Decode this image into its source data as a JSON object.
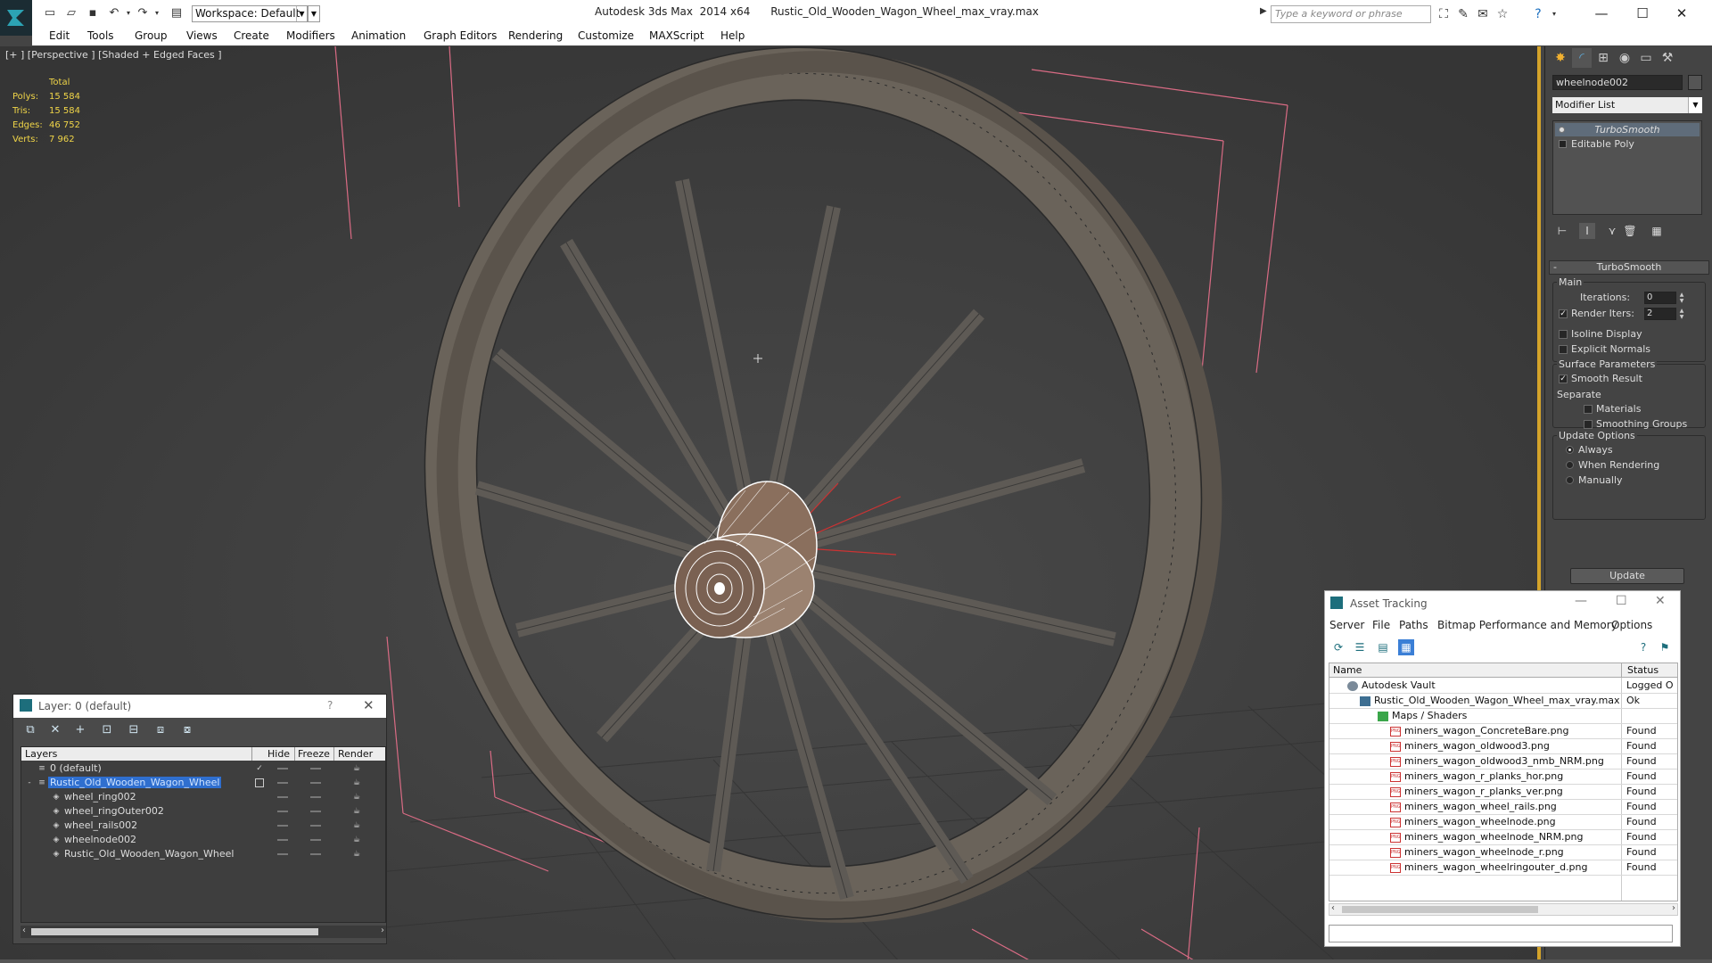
{
  "titlebar": {
    "workspace": "Workspace: Default",
    "app_name": "Autodesk 3ds Max  2014 x64",
    "file_name": "Rustic_Old_Wooden_Wagon_Wheel_max_vray.max",
    "search_placeholder": "Type a keyword or phrase"
  },
  "menu": [
    "Edit",
    "Tools",
    "Group",
    "Views",
    "Create",
    "Modifiers",
    "Animation",
    "Graph Editors",
    "Rendering",
    "Customize",
    "MAXScript",
    "Help"
  ],
  "viewport": {
    "label": "[+ ] [Perspective ] [Shaded + Edged Faces ]",
    "stats": {
      "header": "Total",
      "rows": [
        {
          "k": "Polys:",
          "v": "15 584"
        },
        {
          "k": "Tris:",
          "v": "15 584"
        },
        {
          "k": "Edges:",
          "v": "46 752"
        },
        {
          "k": "Verts:",
          "v": "7 962"
        }
      ]
    }
  },
  "command_panel": {
    "object_name": "wheelnode002",
    "modifier_list": "Modifier List",
    "stack": [
      "TurboSmooth",
      "Editable Poly"
    ],
    "turbosmooth": {
      "title": "TurboSmooth",
      "main": "Main",
      "iterations_label": "Iterations:",
      "iterations": "0",
      "render_iters_label": "Render Iters:",
      "render_iters": "2",
      "isoline": "Isoline Display",
      "explicit": "Explicit Normals",
      "surface": "Surface Parameters",
      "smooth_result": "Smooth Result",
      "separate": "Separate",
      "materials": "Materials",
      "smoothing_groups": "Smoothing Groups",
      "update_options": "Update Options",
      "always": "Always",
      "when_rendering": "When Rendering",
      "manually": "Manually",
      "update": "Update"
    }
  },
  "layer_window": {
    "title": "Layer: 0 (default)",
    "help": "?",
    "columns": {
      "layers": "Layers",
      "hide": "Hide",
      "freeze": "Freeze",
      "render": "Render"
    },
    "rows": [
      {
        "name": "0 (default)"
      },
      {
        "name": "Rustic_Old_Wooden_Wagon_Wheel"
      },
      {
        "name": "wheel_ring002"
      },
      {
        "name": "wheel_ringOuter002"
      },
      {
        "name": "wheel_rails002"
      },
      {
        "name": "wheelnode002"
      },
      {
        "name": "Rustic_Old_Wooden_Wagon_Wheel"
      }
    ]
  },
  "asset_window": {
    "title": "Asset Tracking",
    "menu": [
      "Server",
      "File",
      "Paths",
      "Bitmap Performance and Memory",
      "Options"
    ],
    "columns": {
      "name": "Name",
      "status": "Status"
    },
    "rows": [
      {
        "name": "Autodesk Vault",
        "status": "Logged O"
      },
      {
        "name": "Rustic_Old_Wooden_Wagon_Wheel_max_vray.max",
        "status": "Ok"
      },
      {
        "name": "Maps / Shaders",
        "status": ""
      },
      {
        "name": "miners_wagon_ConcreteBare.png",
        "status": "Found"
      },
      {
        "name": "miners_wagon_oldwood3.png",
        "status": "Found"
      },
      {
        "name": "miners_wagon_oldwood3_nmb_NRM.png",
        "status": "Found"
      },
      {
        "name": "miners_wagon_r_planks_hor.png",
        "status": "Found"
      },
      {
        "name": "miners_wagon_r_planks_ver.png",
        "status": "Found"
      },
      {
        "name": "miners_wagon_wheel_rails.png",
        "status": "Found"
      },
      {
        "name": "miners_wagon_wheelnode.png",
        "status": "Found"
      },
      {
        "name": "miners_wagon_wheelnode_NRM.png",
        "status": "Found"
      },
      {
        "name": "miners_wagon_wheelnode_r.png",
        "status": "Found"
      },
      {
        "name": "miners_wagon_wheelringouter_d.png",
        "status": "Found"
      }
    ]
  },
  "colors": {
    "accent": "#d4a32a",
    "stats_text": "#f0d548",
    "selection": "#2f6fcf"
  }
}
